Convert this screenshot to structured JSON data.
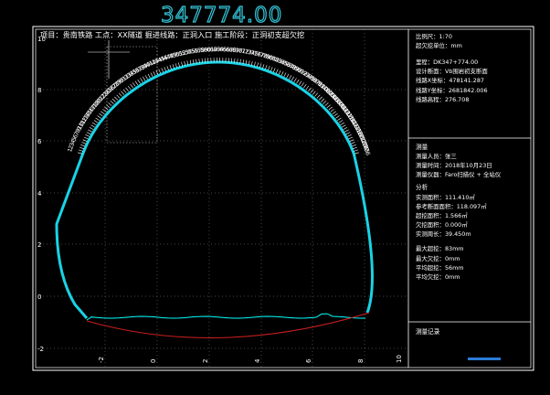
{
  "station_display": "347774.00",
  "header_line": "项目：贵南铁路  工点：XX隧道  掘进线路：正洞入口  施工阶段：正洞初支超欠挖",
  "info": {
    "scale": "比例尺：1:70",
    "unit": "超欠挖单位：mm",
    "mileage": "里程：DK347+774.00",
    "design_section": "设计断面：Vb围岩初支断面",
    "x_coord": "线路X坐标：478141.287",
    "y_coord": "线路Y坐标：2681842.006",
    "elevation": "线路高程：276.708"
  },
  "measure": {
    "title": "测量",
    "person": "测量人员：张三",
    "time": "测量时间：2018年10月23日",
    "instrument": "测量仪器：Faro扫描仪 + 全站仪"
  },
  "analysis": {
    "title": "分析",
    "measured_area": "实测面积：111.410㎡",
    "reference_area": "参考断面面积：118.097㎡",
    "over_area": "超挖面积：1.566㎡",
    "under_area": "欠挖面积：0.000㎡",
    "perimeter": "实测周长：39.450m",
    "max_over": "最大超挖：83mm",
    "max_under": "最大欠挖：0mm",
    "avg_over": "平均超挖：56mm",
    "avg_under": "平均欠挖：0mm"
  },
  "record": {
    "title": "测量记录"
  },
  "y_axis_labels": [
    "10",
    "8",
    "6",
    "4",
    "2",
    "0",
    "-2"
  ],
  "x_axis_labels": [
    "-2",
    "0",
    "2",
    "4",
    "6",
    "8",
    "10"
  ],
  "point_labels_left": [
    "63",
    "62",
    "61",
    "60",
    "59",
    "58",
    "57",
    "56",
    "55",
    "54",
    "53",
    "52",
    "51",
    "50",
    "49",
    "48",
    "47",
    "46",
    "45",
    "44",
    "43",
    "42",
    "41",
    "40",
    "39",
    "38",
    "37",
    "36",
    "35",
    "34",
    "33",
    "32",
    "31",
    "30",
    "29",
    "28",
    "27",
    "26",
    "25",
    "24",
    "23",
    "22",
    "21",
    "20",
    "19",
    "18",
    "17",
    "16",
    "15",
    "14",
    "13",
    "12",
    "11",
    "10",
    "9",
    "8",
    "7",
    "6",
    "5",
    "4",
    "3",
    "2",
    "1"
  ],
  "point_labels_right": [
    "64",
    "65",
    "66",
    "67",
    "68",
    "69",
    "70",
    "71",
    "72",
    "73",
    "74",
    "75",
    "76",
    "77",
    "78",
    "79",
    "80",
    "81",
    "82",
    "83",
    "84",
    "85",
    "86",
    "87",
    "88",
    "89",
    "90",
    "91",
    "92",
    "93",
    "94",
    "95",
    "96",
    "97",
    "98",
    "99",
    "100",
    "101",
    "102",
    "103",
    "104",
    "105",
    "106",
    "107",
    "108",
    "109",
    "110",
    "111",
    "112",
    "113",
    "114",
    "115",
    "116",
    "117",
    "118",
    "119",
    "120",
    "121",
    "122",
    "123",
    "124",
    "125",
    "126"
  ],
  "colors": {
    "background": "#000000",
    "frame": "#ffffff",
    "design_profile": "#19d3e6",
    "measured_profile": "#00ffff",
    "invert_profile": "#cc1f1f",
    "station_text": "#34c6d8",
    "record_bar": "#2b7bd6"
  }
}
